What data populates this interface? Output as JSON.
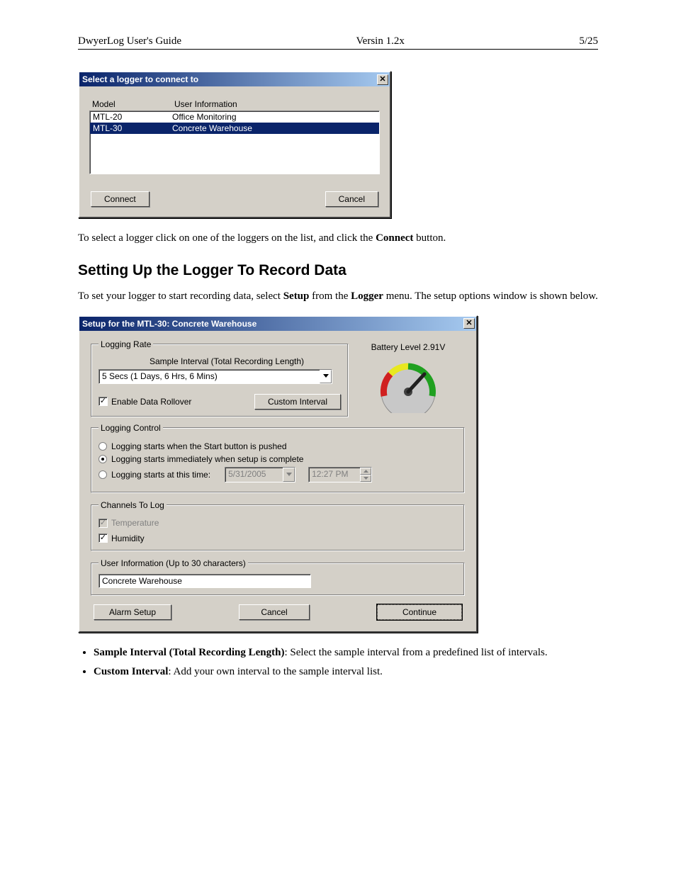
{
  "header": {
    "left": "DwyerLog User's Guide",
    "center": "Versin 1.2x",
    "right": "5/25"
  },
  "dialog1": {
    "title": "Select a logger to connect to",
    "close_symbol": "✕",
    "col_model": "Model",
    "col_user": "User Information",
    "rows": [
      {
        "model": "MTL-20",
        "user": "Office Monitoring"
      },
      {
        "model": "MTL-30",
        "user": "Concrete Warehouse"
      }
    ],
    "connect_label": "Connect",
    "cancel_label": "Cancel"
  },
  "para1_pre": "To select a logger click on one of the loggers on the list, and click the ",
  "para1_bold": "Connect",
  "para1_post": " button.",
  "section_heading": "Setting Up the Logger To Record Data",
  "para2_a": "To set your logger to start recording data, select ",
  "para2_b": "Setup",
  "para2_c": " from the ",
  "para2_d": "Logger",
  "para2_e": " menu.  The setup options window is shown below.",
  "dialog2": {
    "title": "Setup for the MTL-30:  Concrete Warehouse",
    "close_symbol": "✕",
    "logging_rate_legend": "Logging Rate",
    "sample_interval_label": "Sample Interval  (Total Recording Length)",
    "sample_interval_value": "5 Secs  (1 Days, 6 Hrs, 6 Mins)",
    "enable_rollover_label": "Enable Data Rollover",
    "custom_interval_label": "Custom Interval",
    "battery_label": "Battery Level 2.91V",
    "logging_control_legend": "Logging Control",
    "radio1": "Logging starts when the Start button is pushed",
    "radio2": "Logging starts immediately when setup is complete",
    "radio3": "Logging starts at this time:",
    "date_value": "5/31/2005",
    "time_value": "12:27 PM",
    "channels_legend": "Channels To Log",
    "ch_temp": "Temperature",
    "ch_hum": "Humidity",
    "userinfo_legend": "User Information (Up to 30 characters)",
    "userinfo_value": "Concrete Warehouse",
    "alarm_label": "Alarm Setup",
    "cancel_label": "Cancel",
    "continue_label": "Continue"
  },
  "bullets": {
    "b1_bold": "Sample Interval (Total Recording Length)",
    "b1_rest": ":  Select the sample interval from a predefined list of intervals.",
    "b2_bold": "Custom Interval",
    "b2_rest": ":  Add your own interval to the sample interval list."
  }
}
